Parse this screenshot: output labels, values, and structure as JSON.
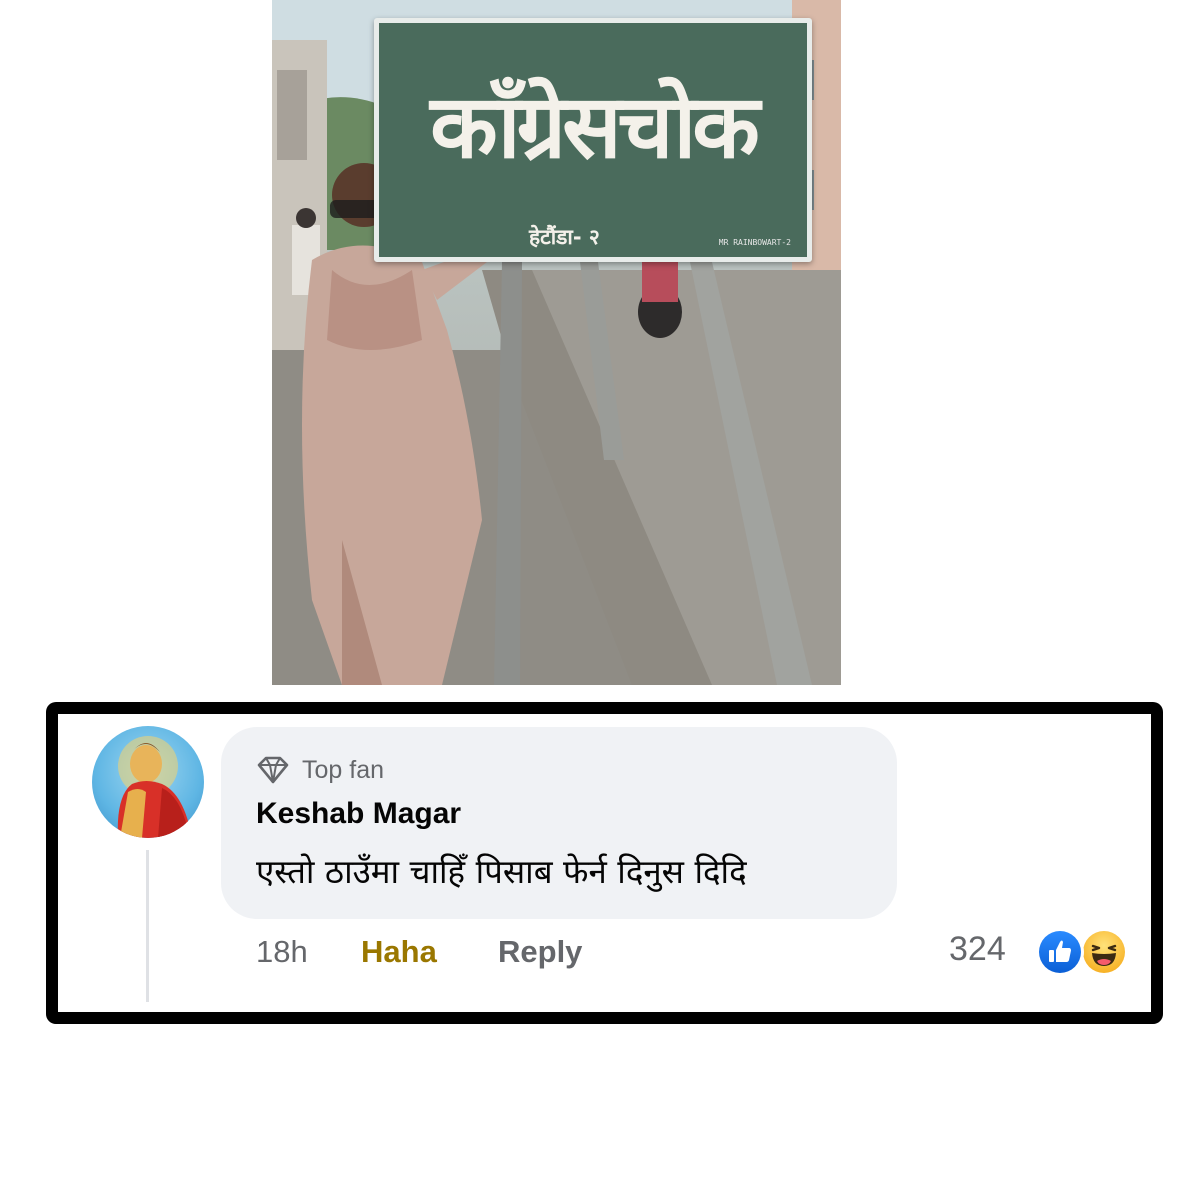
{
  "photo": {
    "sign_main": "काँग्रेसचोक",
    "sign_sub": "हेटौंडा- २",
    "sign_tag": "MR RAINBOWART-2"
  },
  "comment": {
    "badge_label": "Top fan",
    "badge_icon": "diamond-icon",
    "author": "Keshab Magar",
    "text": "एस्तो ठाउँमा चाहिँ पिसाब फेर्न दिनुस दिदि",
    "time": "18h",
    "reaction_action": "Haha",
    "reply_label": "Reply",
    "reaction_count": "324",
    "reactions": [
      "like-reaction-icon",
      "haha-reaction-icon"
    ],
    "colors": {
      "haha_active": "#9a7700",
      "like_blue": "#1877f2",
      "bubble_bg": "#f0f2f5",
      "meta_gray": "#65676b"
    }
  }
}
